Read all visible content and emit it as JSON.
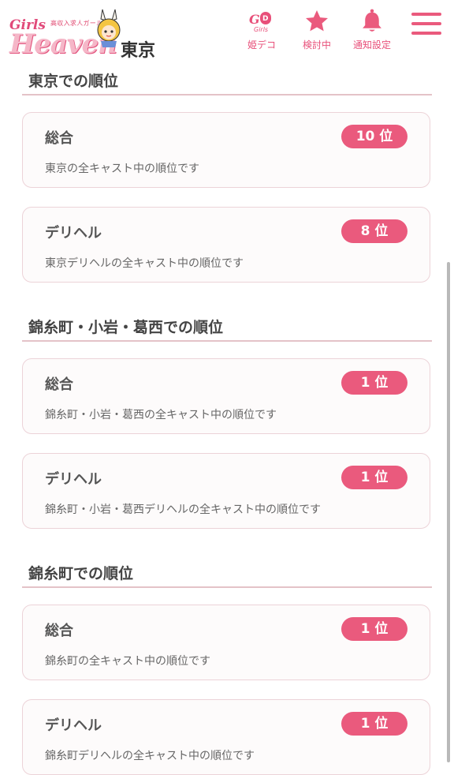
{
  "header": {
    "logo": {
      "tagline": "高収入求人ガールズ",
      "girls": "Girls",
      "heaven": "Heaven",
      "city": "東京"
    },
    "nav": [
      {
        "label": "姫デコ",
        "icon": "deco-logo-icon"
      },
      {
        "label": "検討中",
        "icon": "star-icon"
      },
      {
        "label": "通知設定",
        "icon": "bell-icon"
      }
    ],
    "menu_icon": "hamburger-icon",
    "accent_color": "#ea5a7d"
  },
  "sections": [
    {
      "title": "東京での順位",
      "cards": [
        {
          "title": "総合",
          "rank": "10 位",
          "desc": "東京の全キャスト中の順位です"
        },
        {
          "title": "デリヘル",
          "rank": "8 位",
          "desc": "東京デリヘルの全キャスト中の順位です"
        }
      ]
    },
    {
      "title": "錦糸町・小岩・葛西での順位",
      "cards": [
        {
          "title": "総合",
          "rank": "1 位",
          "desc": "錦糸町・小岩・葛西の全キャスト中の順位です"
        },
        {
          "title": "デリヘル",
          "rank": "1 位",
          "desc": "錦糸町・小岩・葛西デリヘルの全キャスト中の順位です"
        }
      ]
    },
    {
      "title": "錦糸町での順位",
      "cards": [
        {
          "title": "総合",
          "rank": "1 位",
          "desc": "錦糸町の全キャスト中の順位です"
        },
        {
          "title": "デリヘル",
          "rank": "1 位",
          "desc": "錦糸町デリヘルの全キャスト中の順位です"
        }
      ]
    }
  ]
}
